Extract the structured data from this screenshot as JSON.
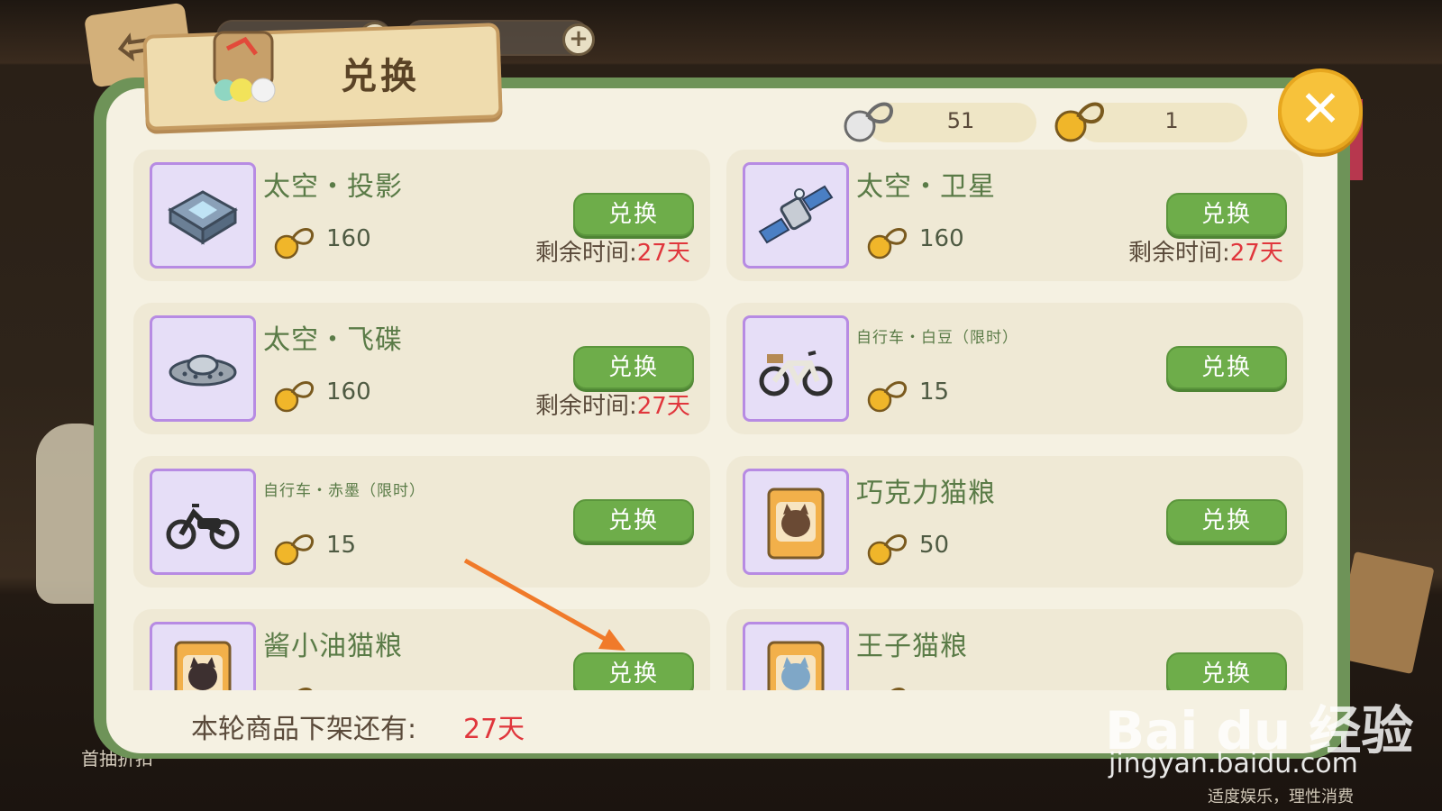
{
  "dialog": {
    "title": "兑换",
    "close_label": "✕"
  },
  "currencies": [
    {
      "name": "silver-key",
      "value": "51"
    },
    {
      "name": "gold-key",
      "value": "1"
    }
  ],
  "items": [
    {
      "name": "太空・投影",
      "cost": "160",
      "button": "兑换",
      "remain_label": "剩余时间:",
      "remain_days": "27天",
      "icon": "projector-icon",
      "name_small": false
    },
    {
      "name": "太空・卫星",
      "cost": "160",
      "button": "兑换",
      "remain_label": "剩余时间:",
      "remain_days": "27天",
      "icon": "satellite-icon",
      "name_small": false
    },
    {
      "name": "太空・飞碟",
      "cost": "160",
      "button": "兑换",
      "remain_label": "剩余时间:",
      "remain_days": "27天",
      "icon": "ufo-icon",
      "name_small": false
    },
    {
      "name": "自行车・白豆（限时）",
      "cost": "15",
      "button": "兑换",
      "icon": "bicycle-icon",
      "name_small": true
    },
    {
      "name": "自行车・赤墨（限时）",
      "cost": "15",
      "button": "兑换",
      "icon": "motorbike-icon",
      "name_small": true
    },
    {
      "name": "巧克力猫粮",
      "cost": "50",
      "button": "兑换",
      "icon": "cat-food-bag-icon",
      "name_small": false
    },
    {
      "name": "酱小油猫粮",
      "cost": "",
      "button": "兑换",
      "icon": "cat-food-bag-icon",
      "name_small": false
    },
    {
      "name": "王子猫粮",
      "cost": "",
      "button": "兑换",
      "icon": "cat-food-bag-icon",
      "name_small": false
    }
  ],
  "footer": {
    "label": "本轮商品下架还有:",
    "days": "27天"
  },
  "background": {
    "left_label": "首抽折扣",
    "note": "适度娱乐，理性消费"
  },
  "watermark": {
    "brand": "Bai du 经验",
    "site": "jingyan.baidu.com"
  },
  "colors": {
    "panel_green": "#6e9358",
    "button_green": "#6ead4a",
    "accent_red": "#e0363c",
    "thumb_purple": "#b78be3",
    "close_yellow": "#f7c23b"
  }
}
